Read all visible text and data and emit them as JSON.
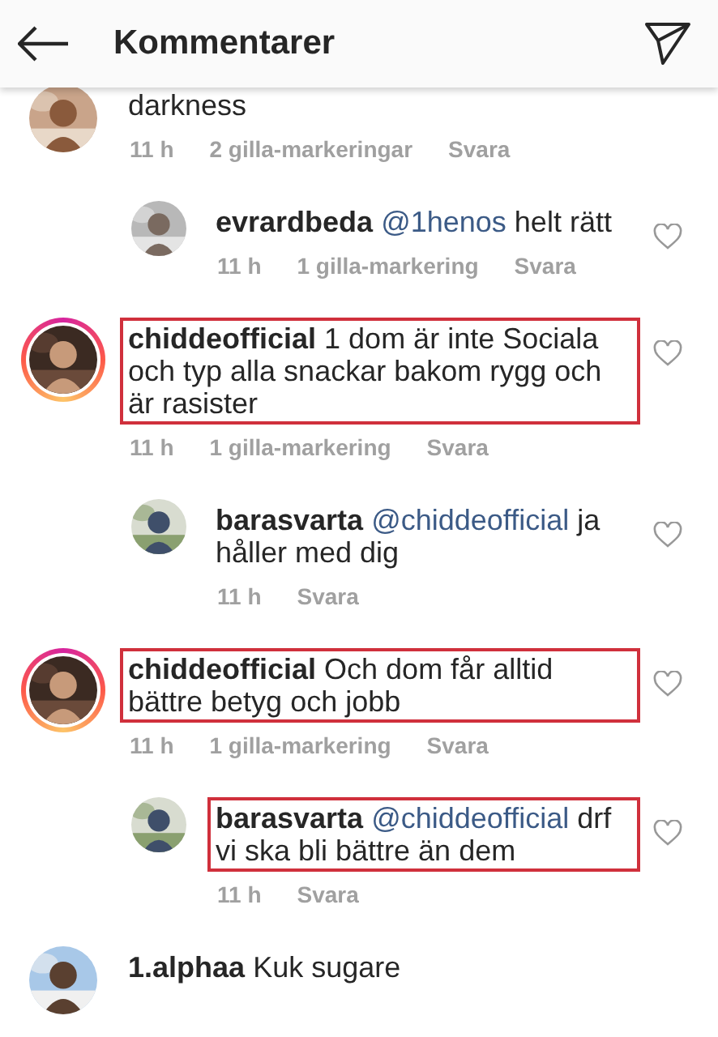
{
  "header": {
    "title": "Kommentarer"
  },
  "comments": [
    {
      "kind": "comment",
      "text": "darkness",
      "story_ring": false,
      "highlighted": false,
      "heart": false,
      "time": "11 h",
      "likes": "2 gilla-markeringar",
      "reply_label": "Svara"
    },
    {
      "kind": "reply",
      "user": "evrardbeda",
      "mention": "@1henos",
      "text": "helt rätt",
      "story_ring": false,
      "highlighted": false,
      "heart": true,
      "time": "11 h",
      "likes": "1 gilla-markering",
      "reply_label": "Svara"
    },
    {
      "kind": "comment",
      "user": "chiddeofficial",
      "text": "1 dom är inte Sociala och typ alla snackar bakom rygg och är rasister",
      "story_ring": true,
      "highlighted": true,
      "heart": true,
      "time": "11 h",
      "likes": "1 gilla-markering",
      "reply_label": "Svara"
    },
    {
      "kind": "reply",
      "user": "barasvarta",
      "mention": "@chiddeofficial",
      "text": "ja håller med dig",
      "story_ring": false,
      "highlighted": false,
      "heart": true,
      "time": "11 h",
      "reply_label": "Svara"
    },
    {
      "kind": "comment",
      "user": "chiddeofficial",
      "text": "Och dom får alltid bättre betyg och jobb",
      "story_ring": true,
      "highlighted": true,
      "heart": true,
      "time": "11 h",
      "likes": "1 gilla-markering",
      "reply_label": "Svara"
    },
    {
      "kind": "reply",
      "user": "barasvarta",
      "mention": "@chiddeofficial",
      "text": "drf vi ska bli bättre än dem",
      "story_ring": false,
      "highlighted": true,
      "heart": true,
      "time": "11 h",
      "reply_label": "Svara"
    },
    {
      "kind": "comment",
      "user": "1.alphaa",
      "text": "Kuk sugare",
      "story_ring": false,
      "highlighted": false,
      "heart": false
    }
  ]
}
